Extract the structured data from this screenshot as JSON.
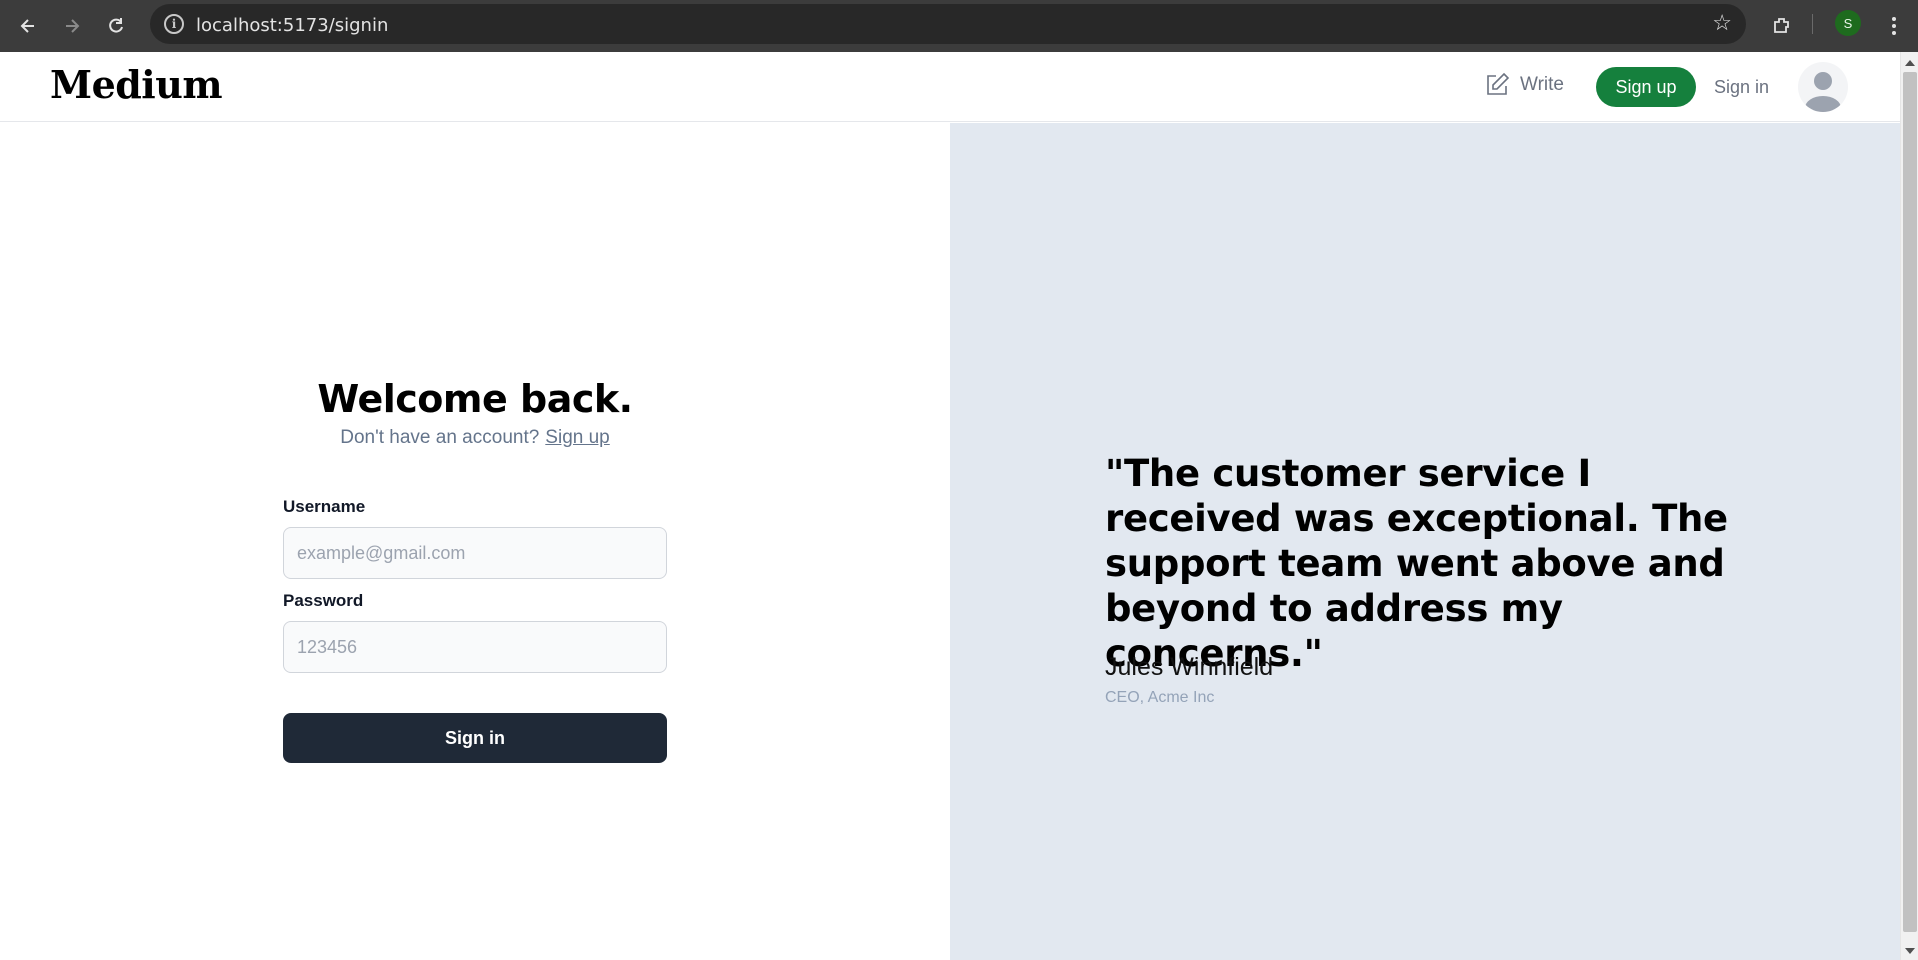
{
  "browser": {
    "url": "localhost:5173/signin",
    "profile_initial": "S"
  },
  "header": {
    "logo": "Medium",
    "write_label": "Write",
    "signup_label": "Sign up",
    "signin_label": "Sign in"
  },
  "signin_form": {
    "heading": "Welcome back.",
    "prompt": "Don't have an account?",
    "signup_link": "Sign up",
    "username_label": "Username",
    "username_placeholder": "example@gmail.com",
    "password_label": "Password",
    "password_placeholder": "123456",
    "submit_label": "Sign in"
  },
  "testimonial": {
    "quote": "\"The customer service I received was exceptional. The support team went above and beyond to address my concerns.\"",
    "author": "Jules Winnfield",
    "author_title": "CEO, Acme Inc"
  },
  "colors": {
    "brand_green": "#15803d",
    "dark_button": "#1f2937",
    "testimonial_bg": "#e2e8f0"
  }
}
